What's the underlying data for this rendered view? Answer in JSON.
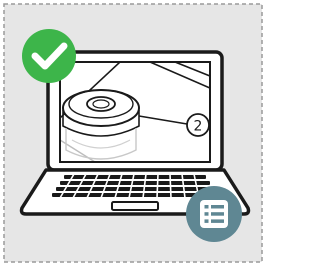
{
  "card": {
    "part_number": "2",
    "icons": {
      "status": "checkmark-icon",
      "action": "list-icon"
    },
    "colors": {
      "page_bg": "#ffffff",
      "card_bg": "#e6e6e6",
      "dashed_border": "#9a9a9a",
      "success": "#3db54a",
      "action_bg": "#5f8793",
      "laptop_outline": "#1a1a1a"
    }
  }
}
